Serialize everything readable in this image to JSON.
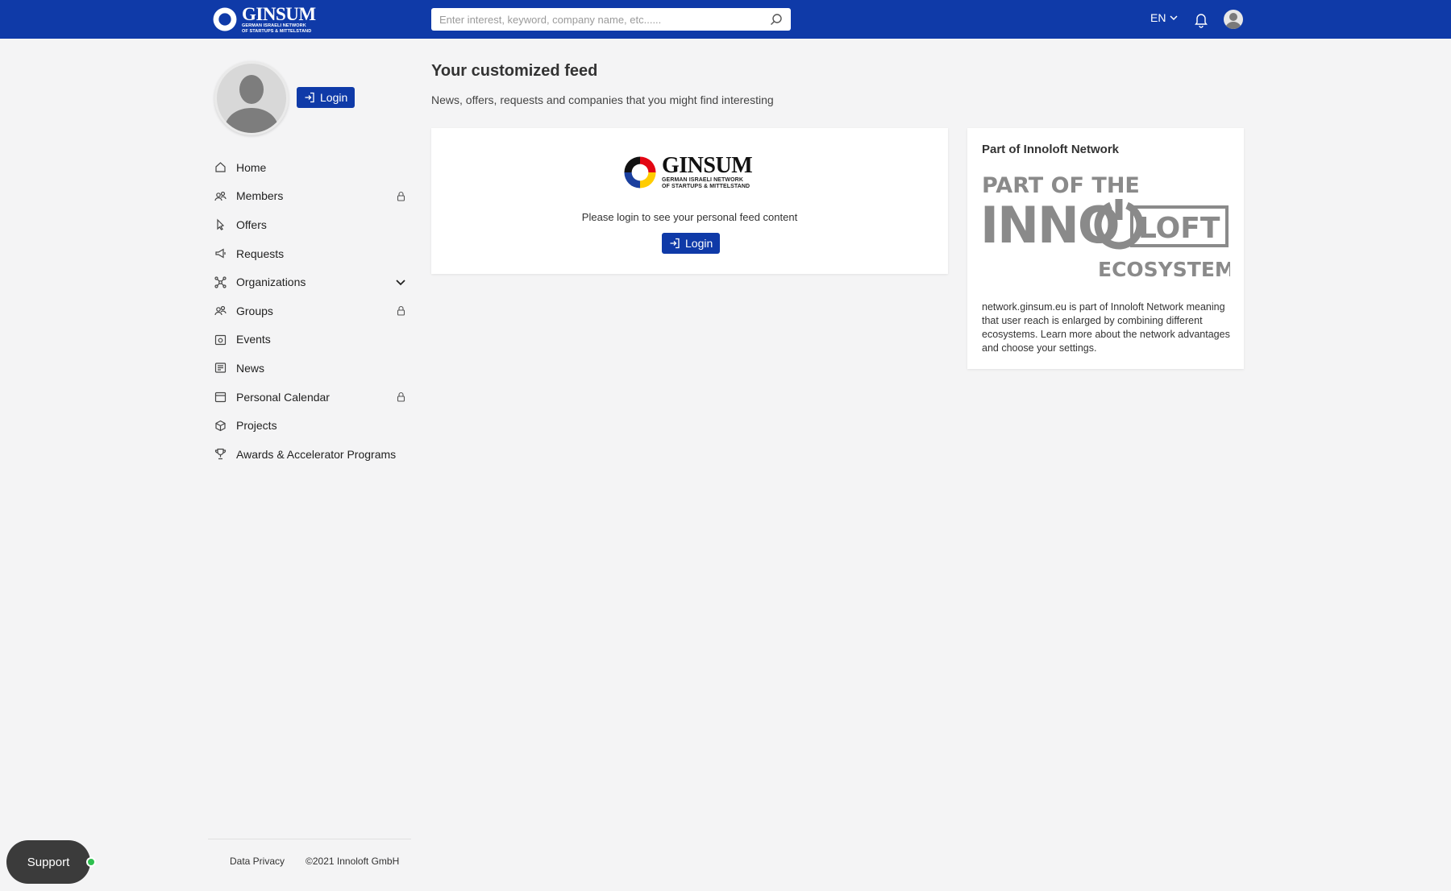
{
  "header": {
    "brand": {
      "name": "GINSUM",
      "sub_line1": "GERMAN ISRAELI NETWORK",
      "sub_line2": "OF STARTUPS & MITTELSTAND"
    },
    "search": {
      "placeholder": "Enter interest, keyword, company name, etc......",
      "icon": "search-icon"
    },
    "language": "EN",
    "notifications_icon": "bell-icon",
    "user_icon": "avatar"
  },
  "sidebar": {
    "login_label": "Login",
    "items": [
      {
        "label": "Home",
        "icon": "home-icon",
        "locked": false
      },
      {
        "label": "Members",
        "icon": "members-icon",
        "locked": true
      },
      {
        "label": "Offers",
        "icon": "offers-icon",
        "locked": false
      },
      {
        "label": "Requests",
        "icon": "megaphone-icon",
        "locked": false
      },
      {
        "label": "Organizations",
        "icon": "organizations-icon",
        "locked": false,
        "expandable": true
      },
      {
        "label": "Groups",
        "icon": "groups-icon",
        "locked": true
      },
      {
        "label": "Events",
        "icon": "events-icon",
        "locked": false
      },
      {
        "label": "News",
        "icon": "news-icon",
        "locked": false
      },
      {
        "label": "Personal Calendar",
        "icon": "calendar-icon",
        "locked": true
      },
      {
        "label": "Projects",
        "icon": "cube-icon",
        "locked": false
      },
      {
        "label": "Awards & Accelerator Programs",
        "icon": "trophy-icon",
        "locked": false
      }
    ],
    "footer": {
      "privacy": "Data Privacy",
      "copyright": "©2021 Innoloft GmbH"
    }
  },
  "feed": {
    "title": "Your customized feed",
    "subtitle": "News, offers, requests and companies that you might find interesting",
    "card": {
      "message": "Please login to see your personal feed content",
      "login_label": "Login"
    }
  },
  "network": {
    "title": "Part of Innoloft Network",
    "logo_line1": "PART OF THE",
    "logo_inno": "INNO",
    "logo_loft": "LOFT",
    "logo_line3": "ECOSYSTEM",
    "description": "network.ginsum.eu is part of Innoloft Network meaning that user reach is enlarged by combining different ecosystems. Learn more about the network advantages and choose your settings."
  },
  "support": {
    "label": "Support",
    "status": "online"
  },
  "colors": {
    "primary": "#0f3aa8",
    "background": "#f4f4f5",
    "support_bg": "#3b3b3b",
    "online": "#2fbf4f"
  }
}
